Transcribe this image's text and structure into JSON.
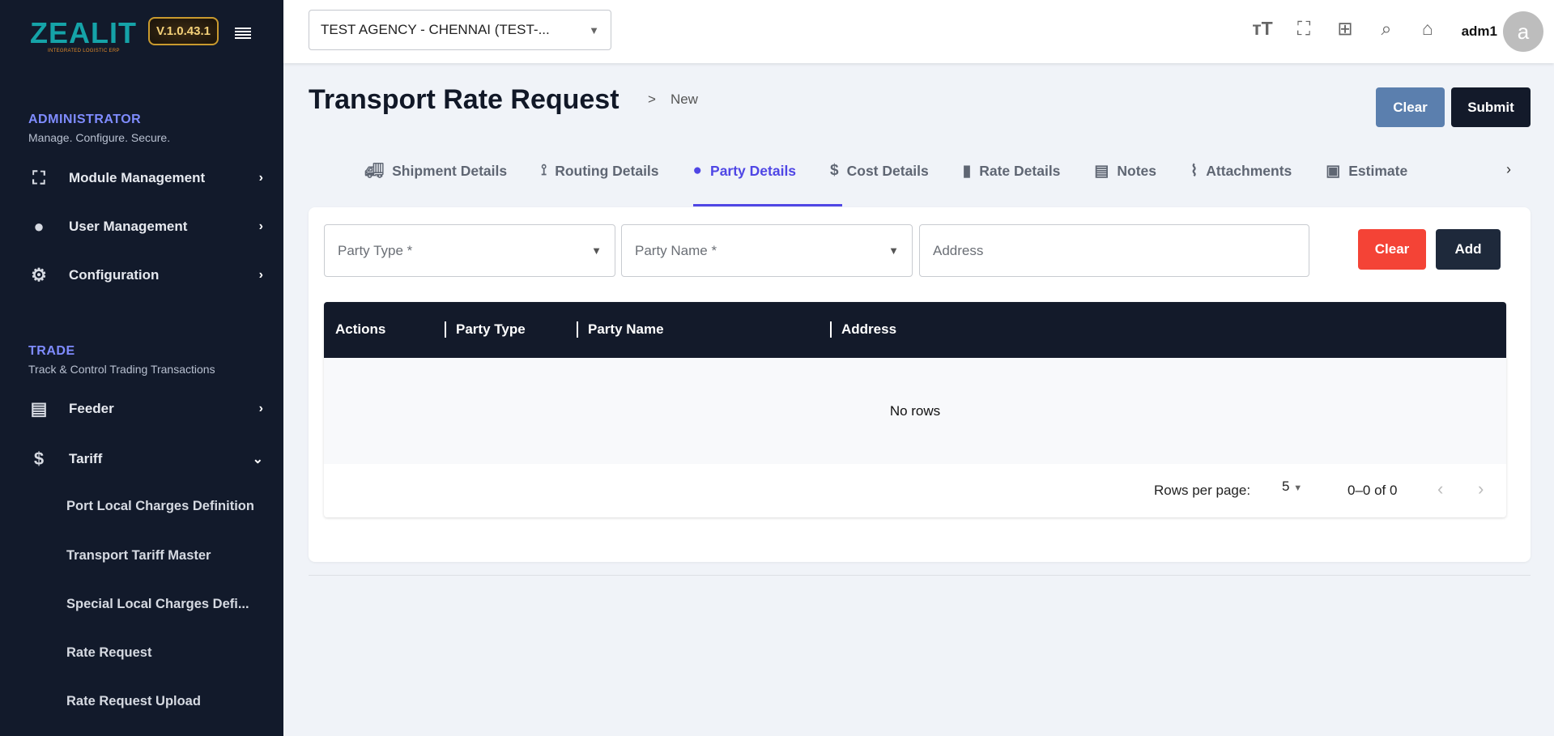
{
  "app": {
    "logo_text": "ZEALIT",
    "logo_tagline": "INTEGRATED LOGISTIC ERP",
    "version": "V.1.0.43.1"
  },
  "sidebar": {
    "sections": [
      {
        "title": "ADMINISTRATOR",
        "subtitle": "Manage. Configure. Secure.",
        "items": [
          {
            "label": "Module Management",
            "icon": "module-tree-icon"
          },
          {
            "label": "User Management",
            "icon": "user-circle-icon"
          },
          {
            "label": "Configuration",
            "icon": "gears-icon"
          }
        ]
      },
      {
        "title": "TRADE",
        "subtitle": "Track & Control Trading Transactions",
        "items": [
          {
            "label": "Feeder",
            "icon": "document-icon"
          },
          {
            "label": "Tariff",
            "icon": "dollar-icon",
            "expanded": true
          }
        ]
      }
    ],
    "tariff_children": [
      "Port Local Charges Definition",
      "Transport Tariff Master",
      "Special Local Charges Defi...",
      "Rate Request",
      "Rate Request Upload"
    ]
  },
  "header": {
    "agency": "TEST AGENCY - CHENNAI  (TEST-...",
    "username": "adm1",
    "avatar_letter": "a"
  },
  "page": {
    "title": "Transport Rate Request",
    "breadcrumb_sep": ">",
    "breadcrumb": "New",
    "clear_label": "Clear",
    "submit_label": "Submit"
  },
  "tabs": [
    {
      "label": "Shipment Details",
      "icon": "truck-icon"
    },
    {
      "label": "Routing Details",
      "icon": "route-icon"
    },
    {
      "label": "Party Details",
      "icon": "user-circle-icon",
      "active": true
    },
    {
      "label": "Cost Details",
      "icon": "dollar-circle-icon"
    },
    {
      "label": "Rate Details",
      "icon": "invoice-icon"
    },
    {
      "label": "Notes",
      "icon": "note-icon"
    },
    {
      "label": "Attachments",
      "icon": "paperclip-icon"
    },
    {
      "label": "Estimate",
      "icon": "estimate-icon"
    }
  ],
  "form": {
    "party_type_placeholder": "Party Type *",
    "party_name_placeholder": "Party Name *",
    "address_placeholder": "Address",
    "clear_label": "Clear",
    "add_label": "Add"
  },
  "table": {
    "columns": [
      "Actions",
      "Party Type",
      "Party Name",
      "Address"
    ],
    "empty_text": "No rows",
    "rows_per_page_label": "Rows per page:",
    "rows_per_page": "5",
    "range": "0–0 of 0"
  },
  "colors": {
    "accent": "#4f46e5",
    "sidebar": "#121a2b",
    "danger": "#f44336",
    "dark_button": "#1e293b",
    "clear_blue": "#5b7fae"
  }
}
